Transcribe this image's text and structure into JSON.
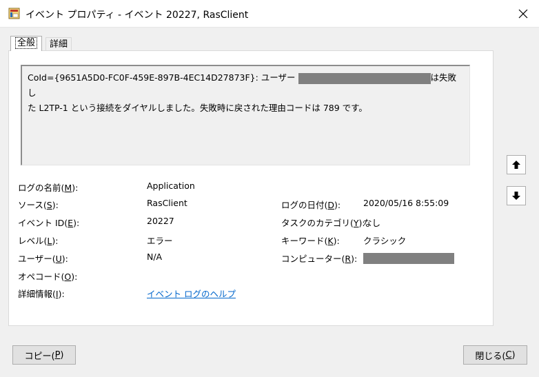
{
  "window": {
    "title": "イベント プロパティ - イベント 20227, RasClient"
  },
  "tabs": [
    {
      "label": "全般"
    },
    {
      "label": "詳細"
    }
  ],
  "message": {
    "part1": "CoId={9651A5D0-FC0F-459E-897B-4EC14D27873F}: ユーザー ",
    "part2": "は失敗し",
    "line2": "た L2TP-1 という接続をダイヤルしました。失敗時に戻された理由コードは 789 です。"
  },
  "fields": {
    "log_name": {
      "label": "ログの名前(",
      "key": "M",
      "suffix": "):",
      "value": "Application"
    },
    "source": {
      "label": "ソース(",
      "key": "S",
      "suffix": "):",
      "value": "RasClient"
    },
    "event_id": {
      "label": "イベント ID(",
      "key": "E",
      "suffix": "):",
      "value": "20227"
    },
    "level": {
      "label": "レベル(",
      "key": "L",
      "suffix": "):",
      "value": "エラー"
    },
    "user": {
      "label": "ユーザー(",
      "key": "U",
      "suffix": "):",
      "value": "N/A"
    },
    "opcode": {
      "label": "オペコード(",
      "key": "O",
      "suffix": "):"
    },
    "more_info": {
      "label": "詳細情報(",
      "key": "I",
      "suffix": "):",
      "value": "イベント ログのヘルプ"
    },
    "logged": {
      "label": "ログの日付(",
      "key": "D",
      "suffix": "):",
      "value": "2020/05/16 8:55:09"
    },
    "task_category": {
      "label": "タスクのカテゴリ(",
      "key": "Y",
      "suffix": "):",
      "value": "なし"
    },
    "keywords": {
      "label": "キーワード(",
      "key": "K",
      "suffix": "):",
      "value": "クラシック"
    },
    "computer": {
      "label": "コンピューター(",
      "key": "R",
      "suffix": "):"
    }
  },
  "buttons": {
    "copy": {
      "label": "コピー(",
      "key": "P",
      "suffix": ")"
    },
    "close": {
      "label": "閉じる(",
      "key": "C",
      "suffix": ")"
    }
  },
  "icons": {
    "up": "arrow-up-icon",
    "down": "arrow-down-icon",
    "close": "close-icon",
    "app": "event-viewer-icon"
  },
  "colors": {
    "redaction": "#808080",
    "link": "#0066cc"
  }
}
